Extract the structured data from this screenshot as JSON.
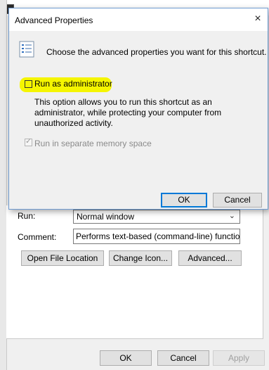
{
  "background_window": {
    "run_label": "Run:",
    "run_value": "Normal window",
    "comment_label": "Comment:",
    "comment_value": "Performs text-based (command-line) functions.",
    "buttons": {
      "open_file_location": "Open File Location",
      "change_icon": "Change Icon...",
      "advanced": "Advanced..."
    },
    "footer": {
      "ok": "OK",
      "cancel": "Cancel",
      "apply": "Apply"
    }
  },
  "dialog": {
    "title": "Advanced Properties",
    "close_icon": "×",
    "intro": "Choose the advanced properties you want for this shortcut.",
    "run_as_admin": {
      "label": "Run as administrator",
      "checked": false
    },
    "description": "This option allows you to run this shortcut as an administrator, while protecting your computer from unauthorized activity.",
    "separate_memory": {
      "label": "Run in separate memory space",
      "checked": true,
      "disabled": true
    },
    "ok": "OK",
    "cancel": "Cancel"
  },
  "colors": {
    "highlight": "#f5f500",
    "accent": "#0078d7"
  },
  "icons": {
    "dialog_icon": "properties-list-icon",
    "close": "close-icon",
    "select_chevron": "chevron-down-icon",
    "check": "checkmark-icon"
  }
}
